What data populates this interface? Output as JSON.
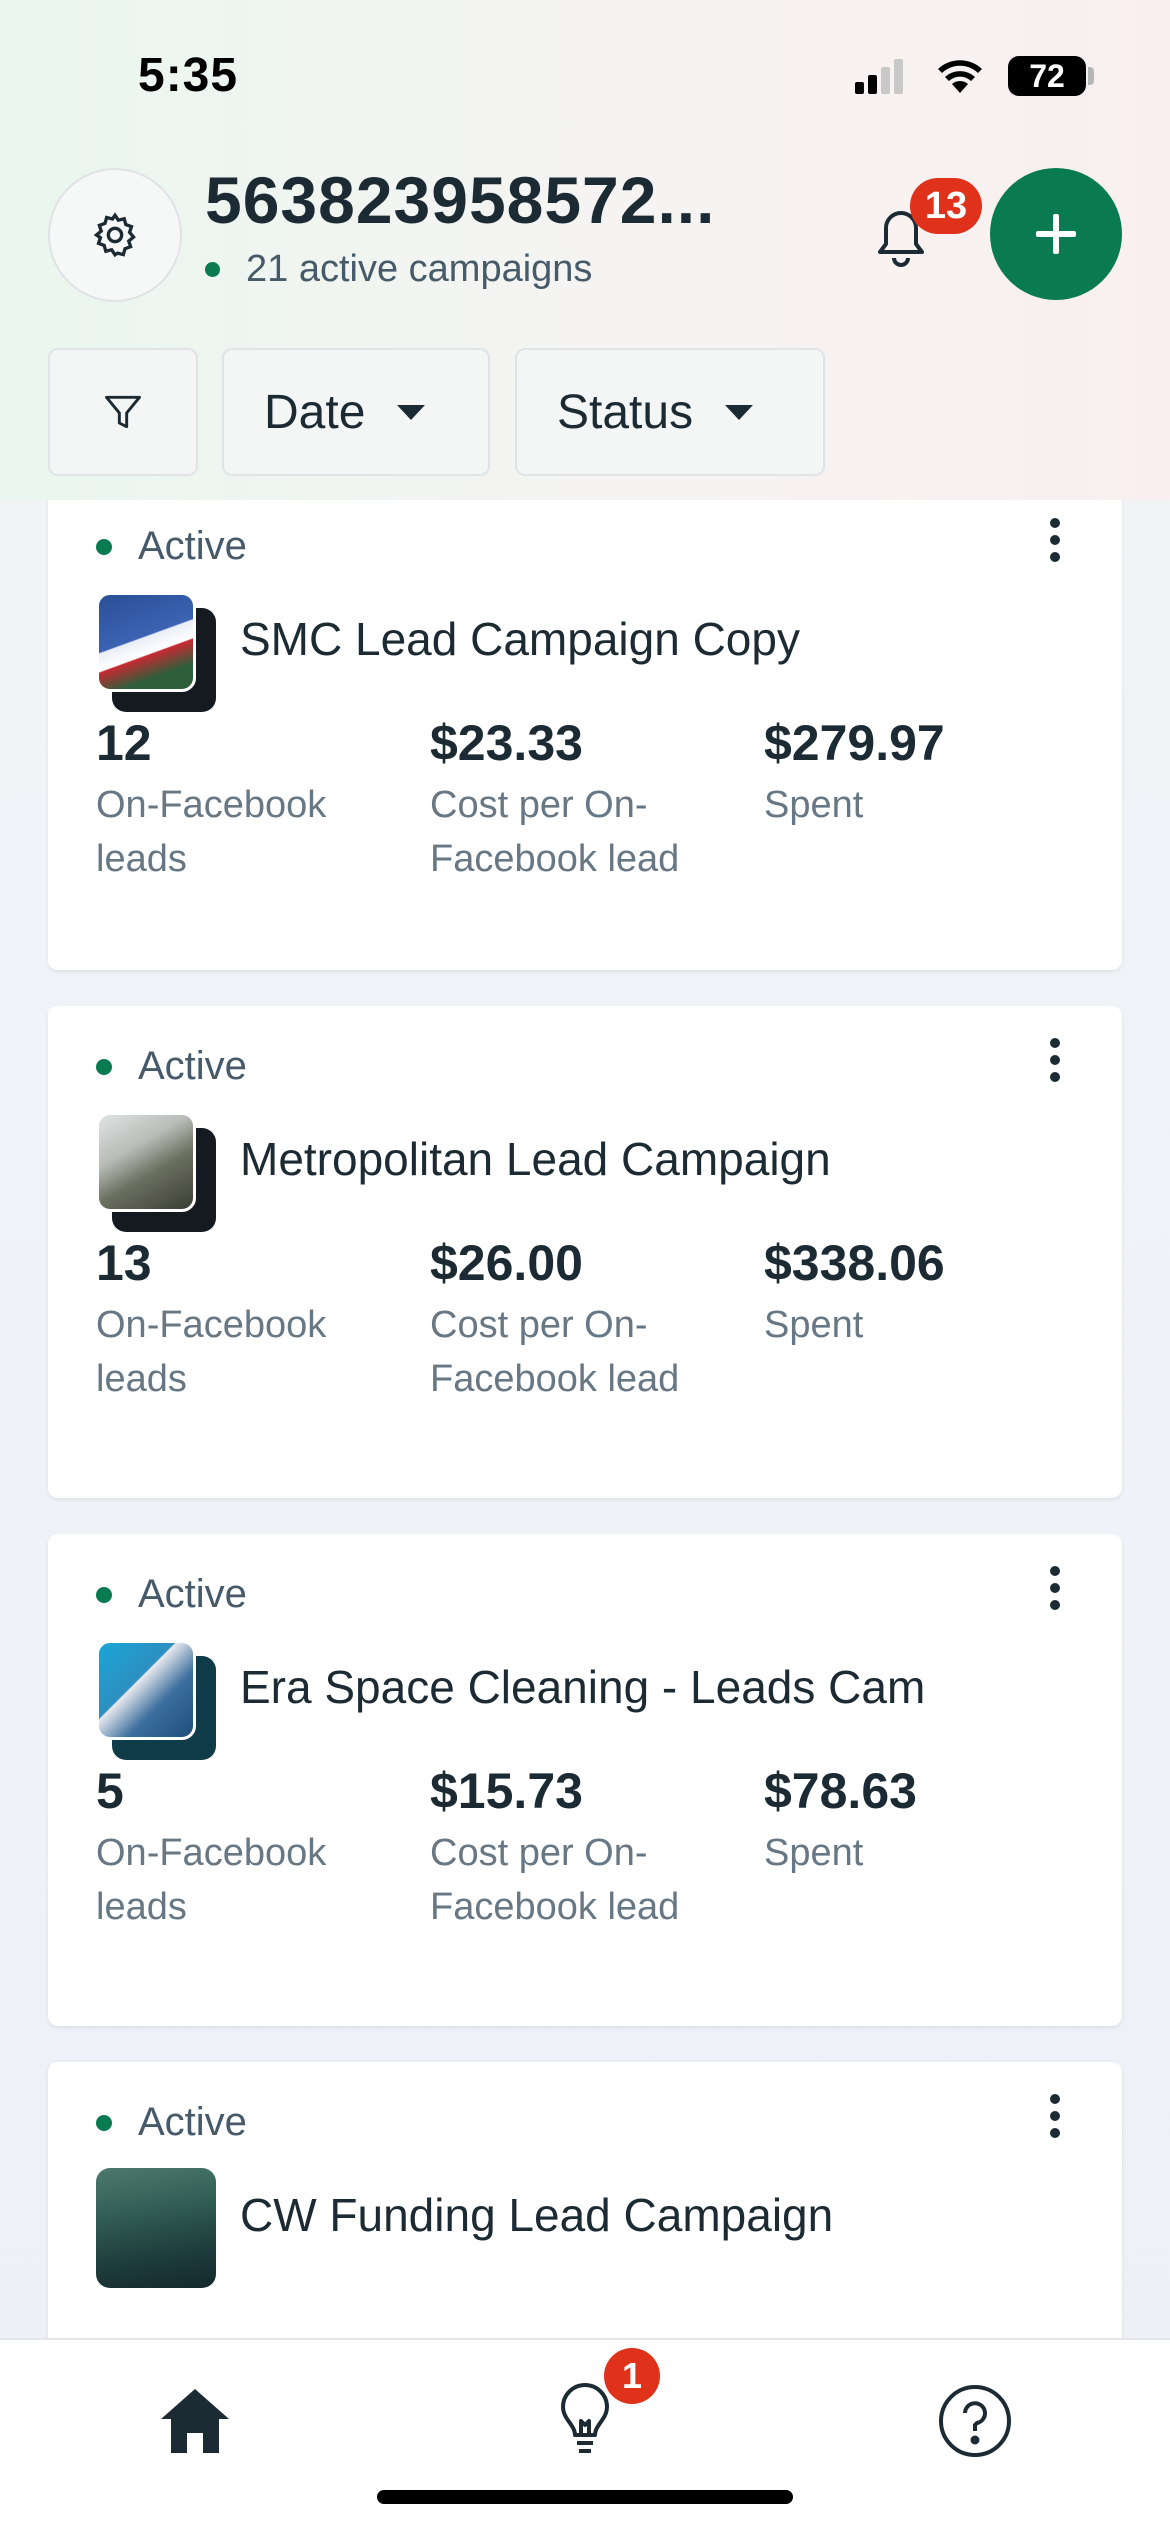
{
  "status_bar": {
    "time": "5:35",
    "battery": "72"
  },
  "header": {
    "account_title": "563823958572...",
    "subtitle": "21 active campaigns",
    "notifications_count": "13"
  },
  "filters": {
    "date_label": "Date",
    "status_label": "Status"
  },
  "campaigns": [
    {
      "status": "Active",
      "name": "SMC Lead Campaign Copy",
      "metrics": [
        {
          "value": "12",
          "label": "On-Facebook leads"
        },
        {
          "value": "$23.33",
          "label": "Cost per On-Facebook lead"
        },
        {
          "value": "$279.97",
          "label": "Spent"
        }
      ]
    },
    {
      "status": "Active",
      "name": "Metropolitan Lead Campaign",
      "metrics": [
        {
          "value": "13",
          "label": "On-Facebook leads"
        },
        {
          "value": "$26.00",
          "label": "Cost per On-Facebook lead"
        },
        {
          "value": "$338.06",
          "label": "Spent"
        }
      ]
    },
    {
      "status": "Active",
      "name": "Era Space Cleaning - Leads Cam",
      "metrics": [
        {
          "value": "5",
          "label": "On-Facebook leads"
        },
        {
          "value": "$15.73",
          "label": "Cost per On-Facebook lead"
        },
        {
          "value": "$78.63",
          "label": "Spent"
        }
      ]
    },
    {
      "status": "Active",
      "name": "CW Funding Lead Campaign",
      "metrics": []
    }
  ],
  "bottom_nav": {
    "items": [
      "home-icon",
      "lightbulb-icon",
      "help-icon"
    ],
    "ideas_badge": "1"
  },
  "colors": {
    "accent": "#0a7a53",
    "badge": "#e0311b",
    "text": "#1c2b33"
  }
}
